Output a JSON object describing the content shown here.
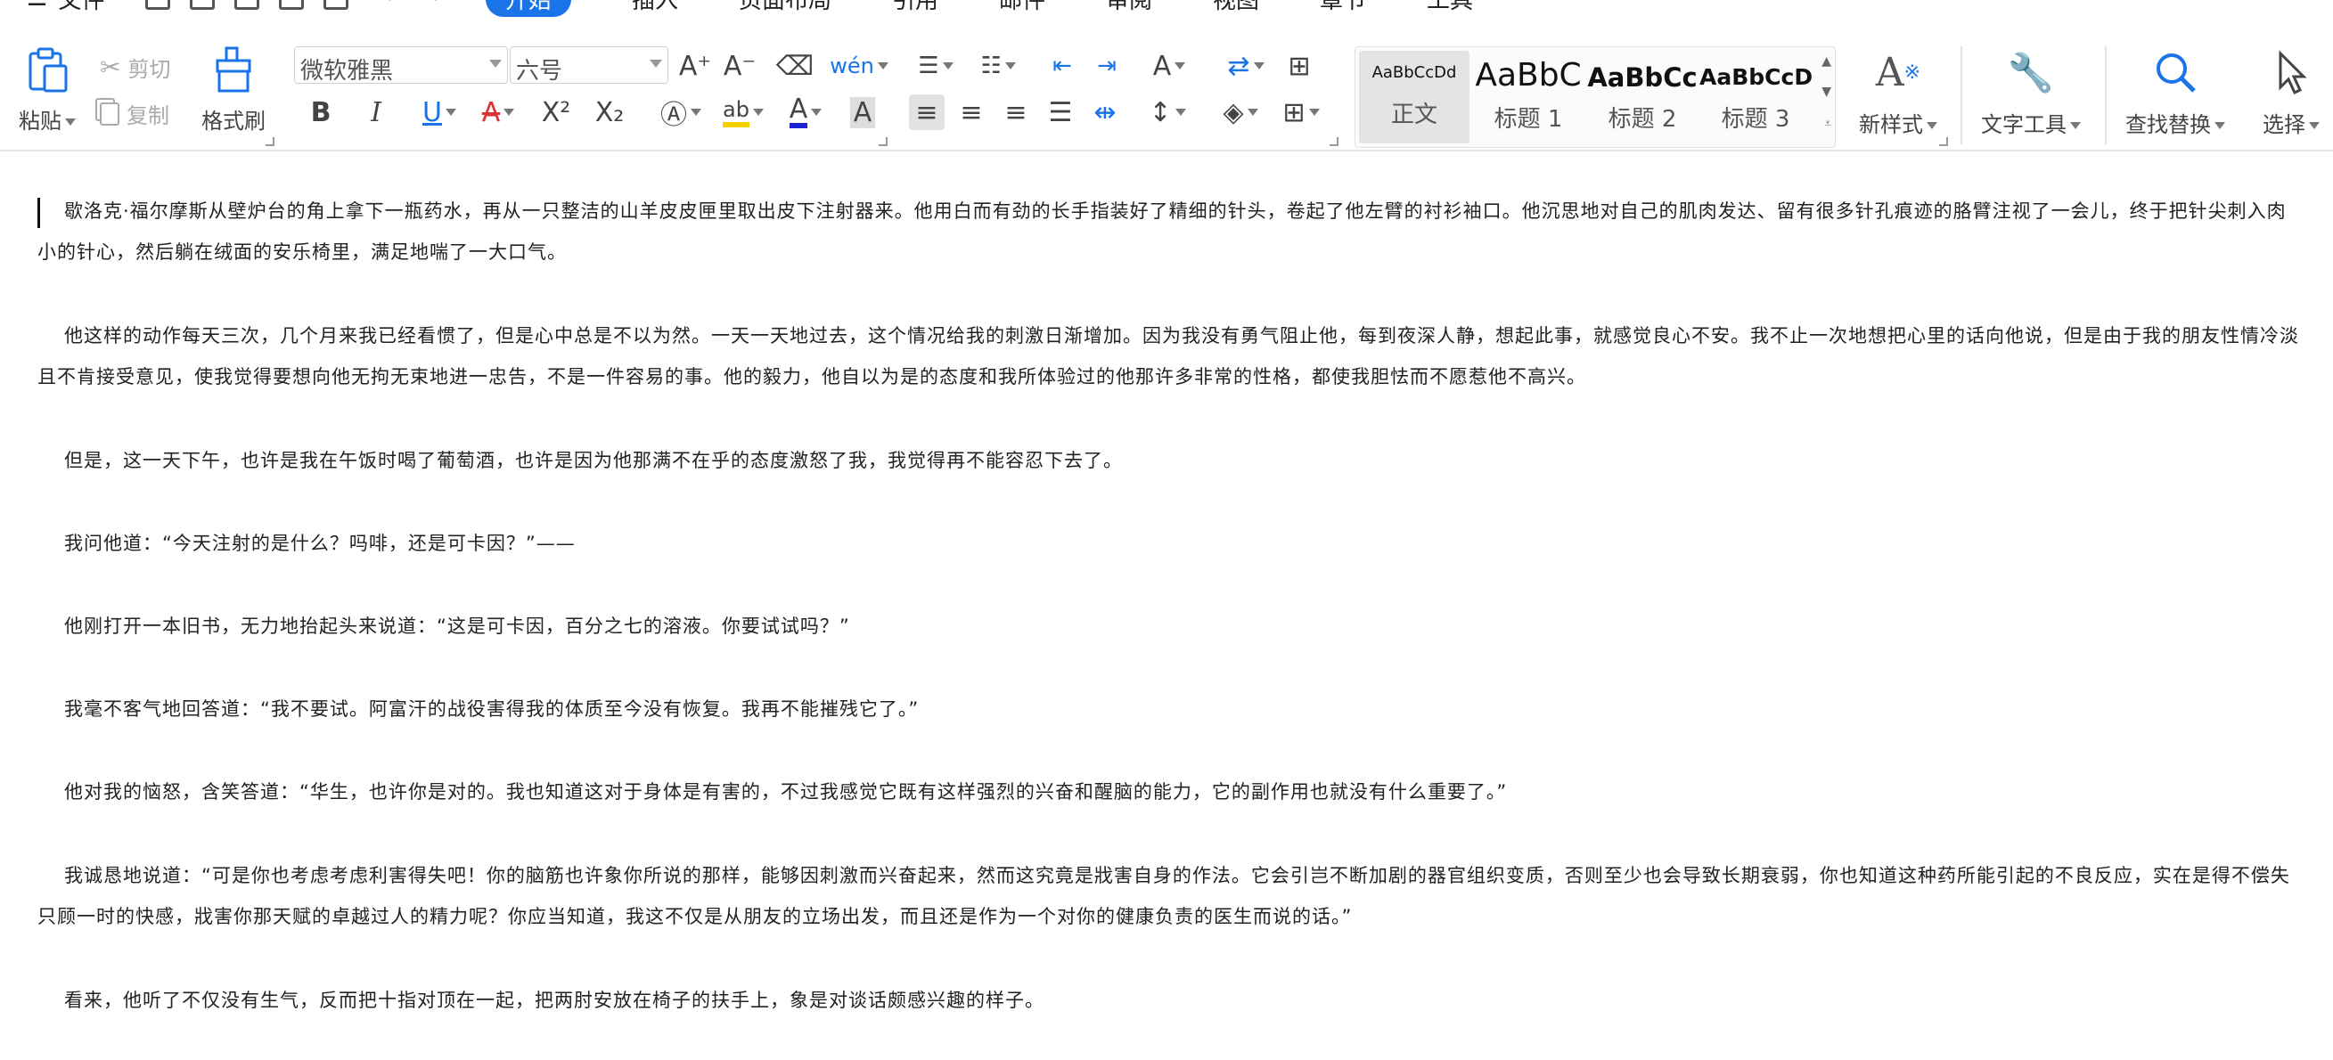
{
  "tabs": {
    "file": "文件",
    "start": "开始",
    "insert": "插入",
    "layout": "页面布局",
    "ref": "引用",
    "mail": "邮件",
    "review": "审阅",
    "view": "视图",
    "chapter": "章节",
    "tools": "工具"
  },
  "clipboard": {
    "paste": "粘贴",
    "cut": "剪切",
    "copy": "复制",
    "format_painter": "格式刷"
  },
  "font": {
    "name": "微软雅黑",
    "size": "六号"
  },
  "styles": [
    {
      "preview": "AaBbCcDd",
      "name": "正文"
    },
    {
      "preview": "AaBbC",
      "name": "标题 1"
    },
    {
      "preview": "AaBbCc",
      "name": "标题 2"
    },
    {
      "preview": "AaBbCcD",
      "name": "标题 3"
    }
  ],
  "actions": {
    "new_style": "新样式",
    "text_tools": "文字工具",
    "find_replace": "查找替换",
    "select": "选择"
  },
  "colors": {
    "accent": "#1a73e8",
    "highlight": "#f5d000",
    "font_color": "#2020d0"
  },
  "paragraphs": [
    "歇洛克·福尔摩斯从壁炉台的角上拿下一瓶药水，再从一只整洁的山羊皮皮匣里取出皮下注射器来。他用白而有劲的长手指装好了精细的针头，卷起了他左臂的衬衫袖口。他沉思地对自己的肌肉发达、留有很多针孔痕迹的胳臂注视了一会儿，终于把针尖刺入肉",
    "小的针心，然后躺在绒面的安乐椅里，满足地喘了一大口气。",
    "他这样的动作每天三次，几个月来我已经看惯了，但是心中总是不以为然。一天一天地过去，这个情况给我的刺激日渐增加。因为我没有勇气阻止他，每到夜深人静，想起此事，就感觉良心不安。我不止一次地想把心里的话向他说，但是由于我的朋友性情冷淡",
    "且不肯接受意见，使我觉得要想向他无拘无束地进一忠告，不是一件容易的事。他的毅力，他自以为是的态度和我所体验过的他那许多非常的性格，都使我胆怯而不愿惹他不高兴。",
    "但是，这一天下午，也许是我在午饭时喝了葡萄酒，也许是因为他那满不在乎的态度激怒了我，我觉得再不能容忍下去了。",
    "我问他道：“今天注射的是什么？吗啡，还是可卡因？”——",
    "他刚打开一本旧书，无力地抬起头来说道：“这是可卡因，百分之七的溶液。你要试试吗？”",
    "我毫不客气地回答道：“我不要试。阿富汗的战役害得我的体质至今没有恢复。我再不能摧残它了。”",
    "他对我的恼怒，含笑答道：“华生，也许你是对的。我也知道这对于身体是有害的，不过我感觉它既有这样强烈的兴奋和醒脑的能力，它的副作用也就没有什么重要了。”",
    "我诚恳地说道：“可是你也考虑考虑利害得失吧！你的脑筋也许象你所说的那样，能够因刺激而兴奋起来，然而这究竟是戕害自身的作法。它会引岂不断加剧的器官组织变质，否则至少也会导致长期衰弱，你也知道这种药所能引起的不良反应，实在是得不偿失",
    "只顾一时的快感，戕害你那天赋的卓越过人的精力呢？你应当知道，我这不仅是从朋友的立场出发，而且还是作为一个对你的健康负责的医生而说的话。”",
    "看来，他听了不仅没有生气，反而把十指对顶在一起，把两肘安放在椅子的扶手上，象是对谈话颇感兴趣的样子。"
  ]
}
